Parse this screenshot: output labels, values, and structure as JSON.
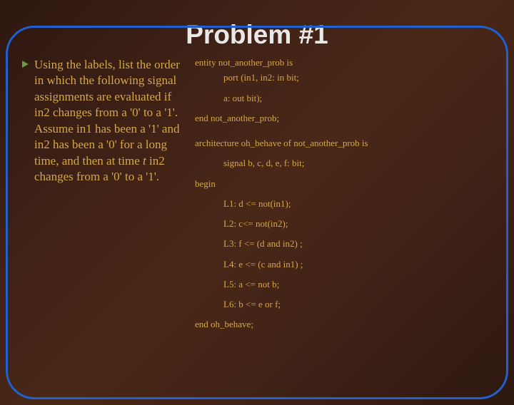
{
  "title": "Problem #1",
  "problem_text_pre": "Using the labels, list the order in which the following signal assignments are evaluated if in2 changes from a '0' to a '1'.  Assume in1 has been a '1' and in2 has been a '0' for a long time, and then at time ",
  "problem_text_italic": "t",
  "problem_text_post": " in2 changes from a '0' to a '1'.",
  "code": {
    "entity_header": "entity not_another_prob is",
    "port_in": "port (in1, in2: in bit;",
    "port_out": "a: out bit);",
    "entity_end": "end not_another_prob;",
    "arch_header": "architecture oh_behave of not_another_prob is",
    "signal_decl": "signal b, c, d, e, f: bit;",
    "begin": "begin",
    "L1": "L1:  d <= not(in1);",
    "L2": "L2:  c<= not(in2);",
    "L3": "L3:  f <= (d and in2) ;",
    "L4": "L4:  e <= (c and in1) ;",
    "L5": "L5:  a <= not b;",
    "L6": "L6:  b <= e or f;",
    "arch_end": "end oh_behave;"
  }
}
